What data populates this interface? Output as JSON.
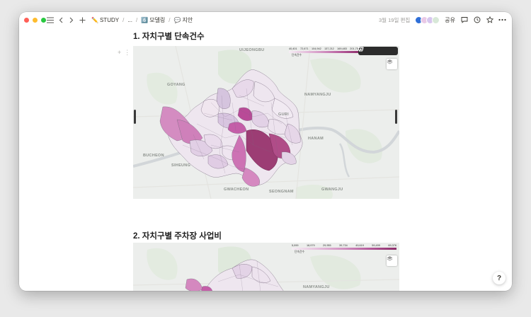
{
  "topbar": {
    "breadcrumbs": [
      {
        "icon": "pencil-emoji",
        "glyph": "✏️",
        "label": "STUDY"
      },
      {
        "icon": "",
        "glyph": "",
        "label": "..."
      },
      {
        "icon": "number-6-emoji",
        "glyph": "6️⃣",
        "label": "모델링"
      },
      {
        "icon": "speech-bubble-emoji",
        "glyph": "💬",
        "label": "지안"
      }
    ],
    "edited": "3월 19일 편집",
    "share_label": "공유"
  },
  "sections": [
    {
      "heading": "1. 자치구별 단속건수"
    },
    {
      "heading": "2. 자치구별 주차장 사업비"
    }
  ],
  "map1": {
    "legend": {
      "ticks": [
        "40,401",
        "72,671",
        "104,942",
        "137,212",
        "169,483",
        "201,753"
      ],
      "caption": "단속건수"
    },
    "labels": {
      "uijeongbu": "UIJEONGBU",
      "goyang": "GOYANG",
      "namyangju": "NAMYANGJU",
      "guri": "GURI",
      "hanam": "HANAM",
      "bucheon": "BUCHEON",
      "gwacheon": "GWACHEON",
      "seongnam": "SEONGNAM",
      "gwangju": "GWANGJU",
      "siheung": "SIHEUNG"
    }
  },
  "map2": {
    "legend": {
      "ticks": [
        "5,099",
        "18,979",
        "29,955",
        "39,734",
        "49,619",
        "59,499",
        "69,376"
      ],
      "caption": "단속건수"
    },
    "labels": {
      "namyangju": "NAMYANGJU"
    }
  },
  "colors": {
    "accent": "#9c3d74",
    "choropleth_low": "#f3e8f2",
    "choropleth_high": "#8c2e6a"
  }
}
